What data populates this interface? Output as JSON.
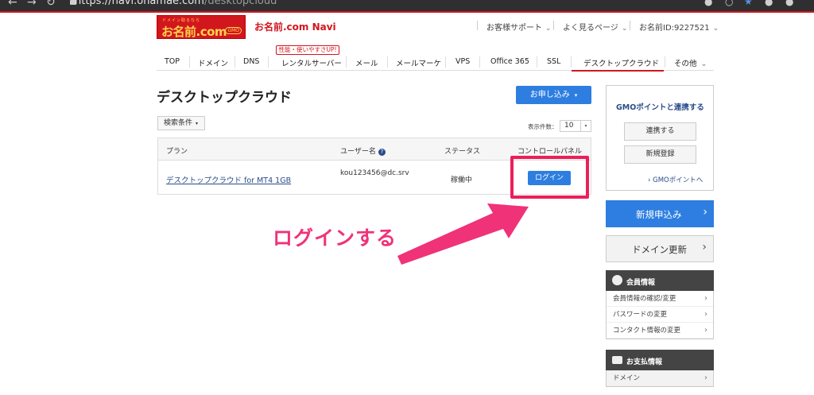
{
  "browser": {
    "url_host": "https://navi.onamae.com",
    "url_path": "/desktopcloud"
  },
  "header": {
    "logo_tagline": "ドメイン取るなら",
    "logo_text": "お名前.com",
    "logo_badge": "GMO",
    "site_title": "お名前.com Navi",
    "support": "お客様サポート",
    "frequent_pages": "よく見るページ",
    "user_id": "お名前ID:9227521"
  },
  "nav": {
    "promo": "性能・使いやすさUP!",
    "tabs": [
      "TOP",
      "ドメイン",
      "DNS",
      "レンタルサーバー",
      "メール",
      "メールマーケ",
      "VPS",
      "Office 365",
      "SSL",
      "デスクトップクラウド",
      "その他"
    ]
  },
  "main": {
    "title": "デスクトップクラウド",
    "apply_button": "お申し込み",
    "filter_button": "検索条件",
    "per_page_label": "表示件数：",
    "per_page_value": "10",
    "table": {
      "headers": [
        "プラン",
        "ユーザー名",
        "ステータス",
        "コントロールパネル"
      ],
      "rows": [
        {
          "plan": "デスクトップクラウド for MT4 1GB",
          "user": "kou123456@dc.srv",
          "status": "稼働中",
          "action": "ログイン"
        }
      ]
    }
  },
  "annotation": {
    "text": "ログインする",
    "color": "#f03278"
  },
  "sidebar": {
    "gmo_title": "GMOポイントと連携する",
    "link_button": "連携する",
    "register_button": "新規登録",
    "gmo_link": "GMOポイントへ",
    "new_application": "新規申込み",
    "domain_renew": "ドメイン更新",
    "member_header": "会員情報",
    "member_items": [
      "会員情報の確認/変更",
      "パスワードの変更",
      "コンタクト情報の変更"
    ],
    "payment_header": "お支払情報",
    "payment_items": [
      "ドメイン"
    ]
  },
  "colors": {
    "brand_red": "#d2161e",
    "primary_blue": "#2d7ee0",
    "link_blue": "#2a4c8a"
  }
}
